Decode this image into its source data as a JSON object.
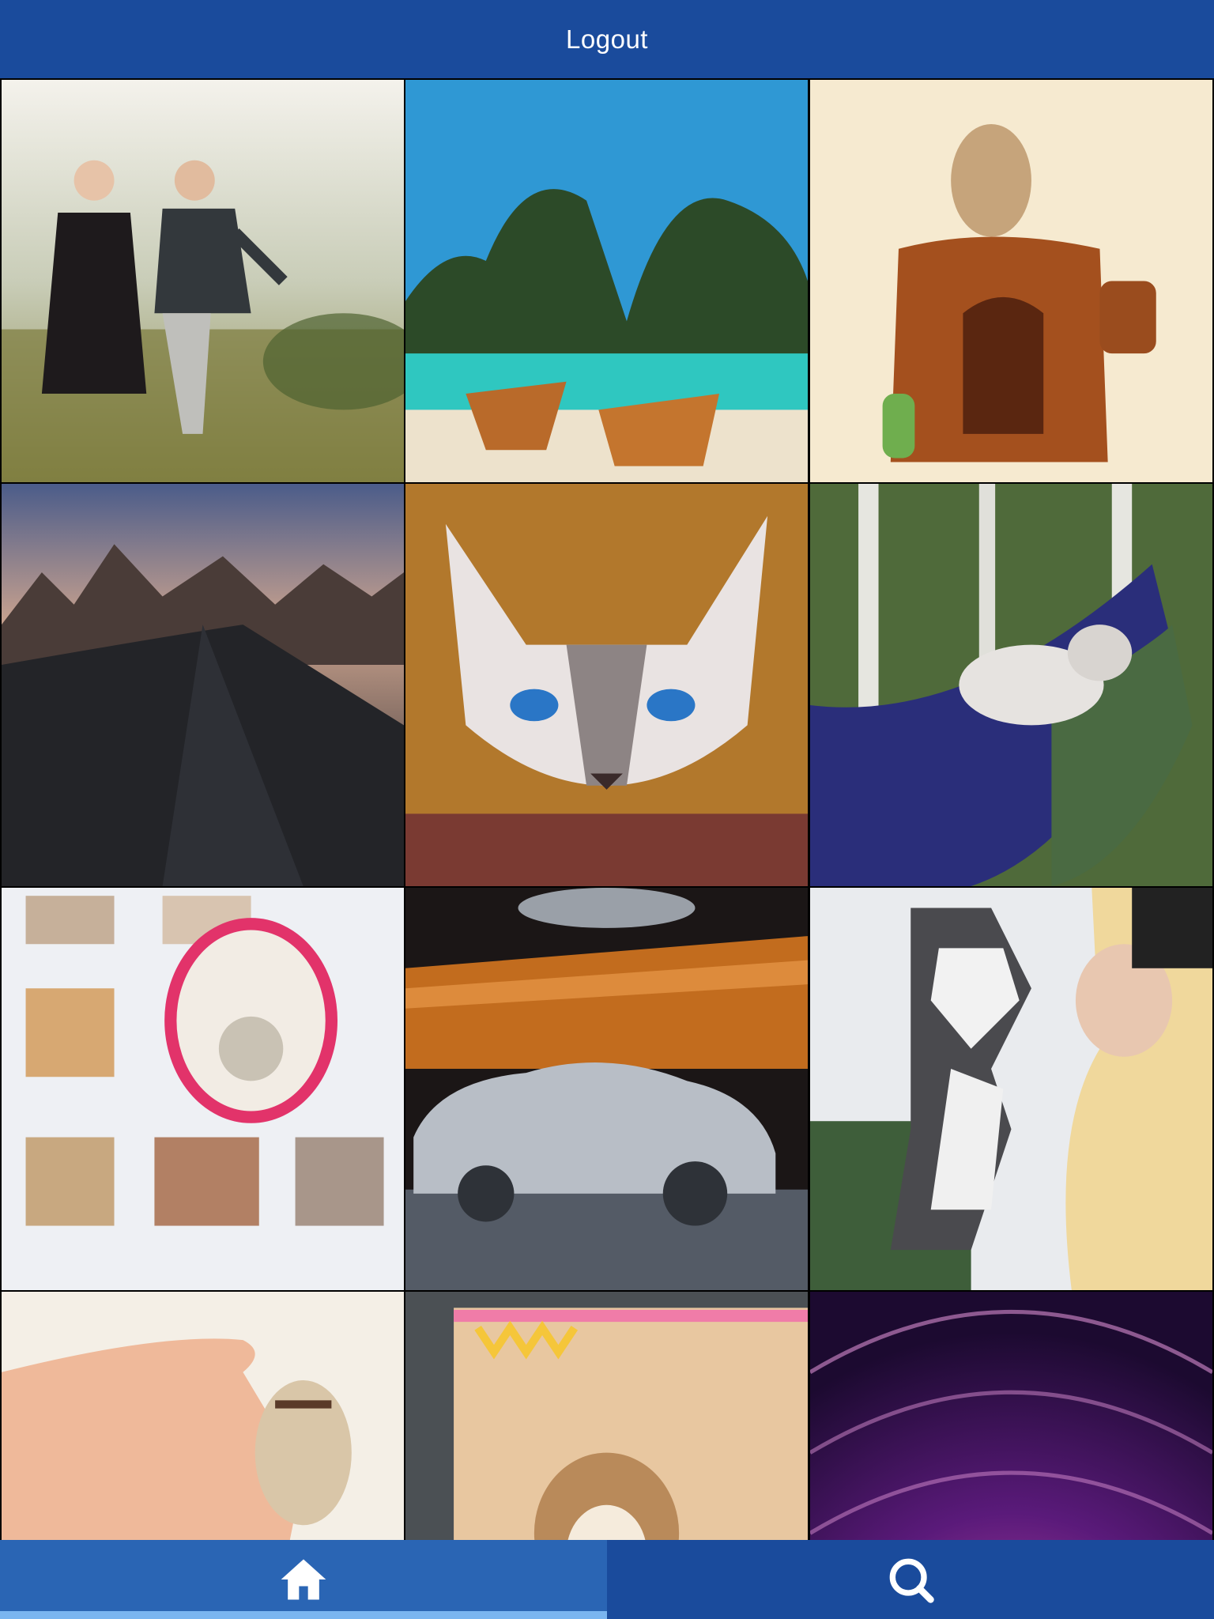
{
  "header": {
    "logout_label": "Logout"
  },
  "photos": [
    {
      "name": "photo-children-kiss-field"
    },
    {
      "name": "photo-tropical-bay-boats"
    },
    {
      "name": "photo-chipmunk-on-log-house"
    },
    {
      "name": "photo-mountains-dunes"
    },
    {
      "name": "photo-blue-eyed-cat"
    },
    {
      "name": "photo-husky-hammock"
    },
    {
      "name": "photo-magazine-page-pets"
    },
    {
      "name": "photo-silver-car-showroom"
    },
    {
      "name": "photo-husky-kiss-woman"
    },
    {
      "name": "photo-hand-holding-chipmunk"
    },
    {
      "name": "photo-chipmunk-card"
    },
    {
      "name": "photo-purple-light-tunnel"
    }
  ],
  "tabbar": {
    "tabs": [
      {
        "id": "home",
        "icon": "home-icon",
        "active": true
      },
      {
        "id": "search",
        "icon": "search-icon",
        "active": false
      }
    ]
  },
  "colors": {
    "primary": "#1a4b9c",
    "active_tab": "#2a65b4",
    "tab_indicator": "#7ab5f0"
  }
}
